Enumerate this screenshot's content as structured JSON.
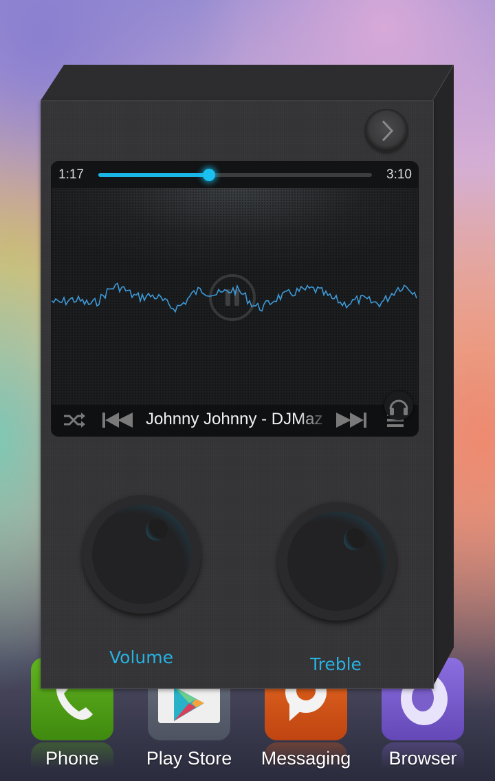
{
  "player": {
    "elapsed": "1:17",
    "duration": "3:10",
    "progress": 0.405,
    "song_title": "Johnny Johnny - DJMaz",
    "accent_color": "#19b5e6",
    "icons": {
      "next_panel": "chevron-right-icon",
      "pause": "pause-icon",
      "headphone": "headphones-icon",
      "shuffle": "shuffle-icon",
      "previous": "skip-previous-icon",
      "next": "skip-next-icon",
      "menu": "menu-icon"
    }
  },
  "knobs": [
    {
      "label": "Volume",
      "level": 0.66
    },
    {
      "label": "Treble",
      "level": 0.7
    }
  ],
  "dock": {
    "apps": [
      {
        "label": "Phone",
        "color": "#4e9e16",
        "icon": "phone-icon"
      },
      {
        "label": "Play Store",
        "color": "#5b6270",
        "icon": "play-store-icon"
      },
      {
        "label": "Messaging",
        "color": "#d35717",
        "icon": "messaging-icon"
      },
      {
        "label": "Browser",
        "color": "#7a5ec9",
        "icon": "browser-icon"
      }
    ]
  }
}
